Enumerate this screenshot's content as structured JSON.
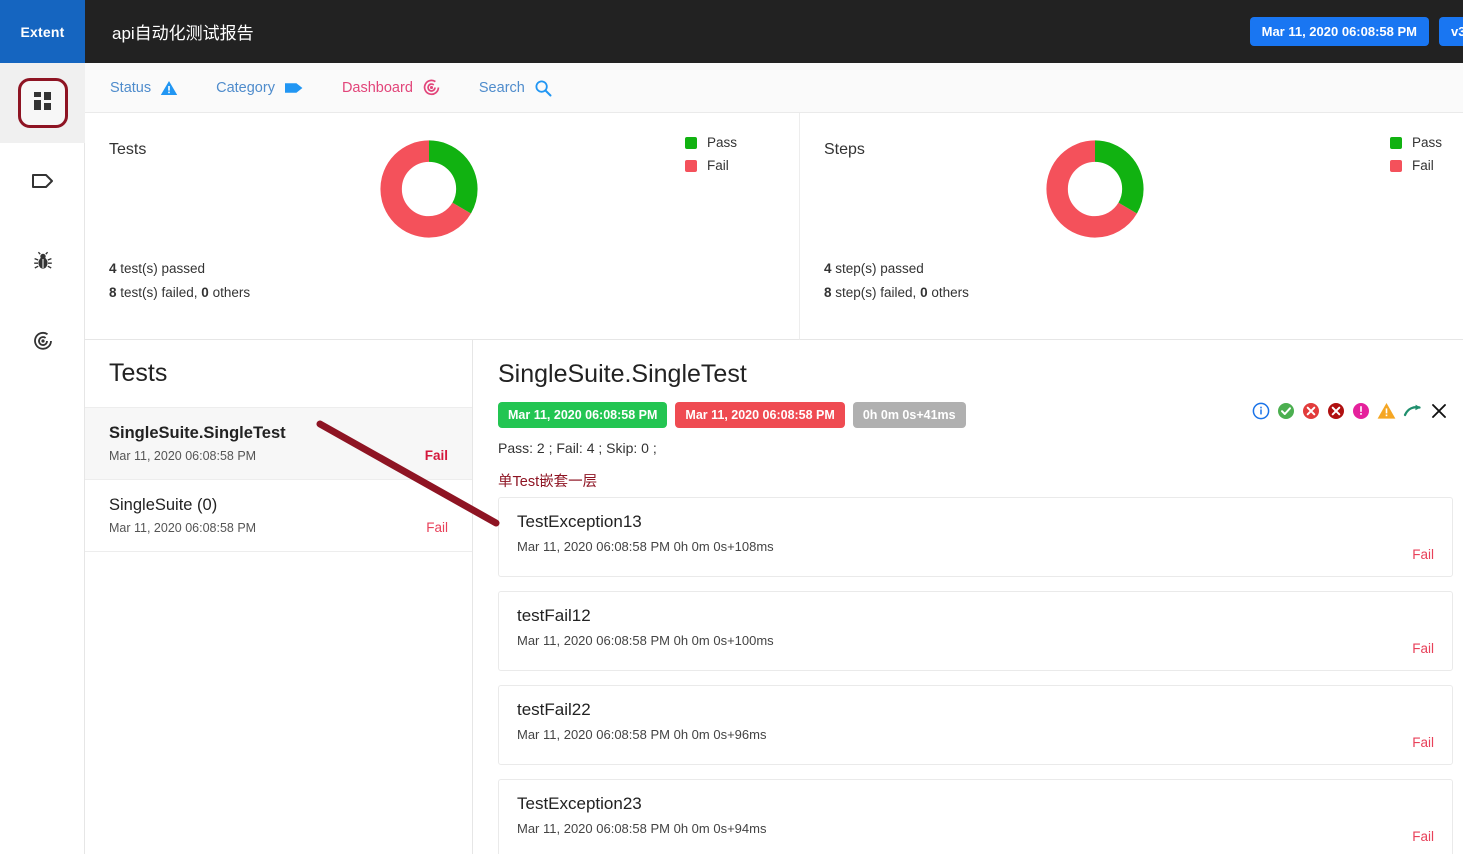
{
  "brand": {
    "logo_text": "Extent"
  },
  "header": {
    "title": "api自动化测试报告",
    "timestamp_badge": "Mar 11, 2020 06:08:58 PM",
    "version_badge": "v3"
  },
  "rail": {
    "items": [
      {
        "name": "dashboard",
        "icon": "grid-icon",
        "active": true
      },
      {
        "name": "categories",
        "icon": "tag-icon",
        "active": false
      },
      {
        "name": "exceptions",
        "icon": "bug-icon",
        "active": false
      },
      {
        "name": "dashboard-alt",
        "icon": "target-icon",
        "active": false
      }
    ]
  },
  "nav": {
    "items": [
      {
        "label": "Status",
        "icon": "warning-triangle-icon",
        "active": false
      },
      {
        "label": "Category",
        "icon": "tag-icon",
        "active": false
      },
      {
        "label": "Dashboard",
        "icon": "target-icon",
        "active": true
      },
      {
        "label": "Search",
        "icon": "search-icon",
        "active": false
      }
    ]
  },
  "charts": [
    {
      "title": "Tests",
      "legend": [
        {
          "label": "Pass",
          "color": "#11b211"
        },
        {
          "label": "Fail",
          "color": "#f4515b"
        }
      ],
      "footer_passed_count": "4",
      "footer_passed_text": " test(s) passed",
      "footer_failed_count": "8",
      "footer_failed_mid": " test(s) failed, ",
      "footer_others_count": "0",
      "footer_others_text": " others"
    },
    {
      "title": "Steps",
      "legend": [
        {
          "label": "Pass",
          "color": "#11b211"
        },
        {
          "label": "Fail",
          "color": "#f4515b"
        }
      ],
      "footer_passed_count": "4",
      "footer_passed_text": " step(s) passed",
      "footer_failed_count": "8",
      "footer_failed_mid": " step(s) failed, ",
      "footer_others_count": "0",
      "footer_others_text": " others"
    }
  ],
  "chart_data": [
    {
      "type": "pie",
      "title": "Tests",
      "variant": "donut",
      "labels": [
        "Pass",
        "Fail"
      ],
      "values": [
        4,
        8
      ],
      "colors": [
        "#11b211",
        "#f4515b"
      ],
      "total": 12,
      "legend_position": "right",
      "annotations": [
        "4 test(s) passed",
        "8 test(s) failed, 0 others"
      ]
    },
    {
      "type": "pie",
      "title": "Steps",
      "variant": "donut",
      "labels": [
        "Pass",
        "Fail"
      ],
      "values": [
        4,
        8
      ],
      "colors": [
        "#11b211",
        "#f4515b"
      ],
      "total": 12,
      "legend_position": "right",
      "annotations": [
        "4 step(s) passed",
        "8 step(s) failed, 0 others"
      ]
    }
  ],
  "tests_panel": {
    "heading": "Tests",
    "rows": [
      {
        "name": "SingleSuite.SingleTest",
        "date": "Mar 11, 2020 06:08:58 PM",
        "status": "Fail",
        "selected": true
      },
      {
        "name": "SingleSuite (0)",
        "date": "Mar 11, 2020 06:08:58 PM",
        "status": "Fail",
        "selected": false
      }
    ]
  },
  "detail": {
    "title": "SingleSuite.SingleTest",
    "pill_start": "Mar 11, 2020 06:08:58 PM",
    "pill_end": "Mar 11, 2020 06:08:58 PM",
    "pill_duration": "0h 0m 0s+41ms",
    "counts": "Pass: 2 ; Fail: 4 ; Skip: 0 ;",
    "icons": [
      {
        "name": "info-icon",
        "color": "#1a73e8"
      },
      {
        "name": "check-circle-icon",
        "color": "#4caf50"
      },
      {
        "name": "fail-circle-icon",
        "color": "#e23b3b"
      },
      {
        "name": "error-circle-icon",
        "color": "#b01010"
      },
      {
        "name": "warning-circle-icon",
        "color": "#e5219c"
      },
      {
        "name": "warning-triangle-icon",
        "color": "#f5a623"
      },
      {
        "name": "skip-arrow-icon",
        "color": "#1f8f6d"
      },
      {
        "name": "close-icon",
        "color": "#111111"
      }
    ],
    "section_label": "单Test嵌套一层",
    "steps": [
      {
        "name": "TestException13",
        "date": "Mar 11, 2020 06:08:58 PM",
        "duration": "0h 0m 0s+108ms",
        "status": "Fail"
      },
      {
        "name": "testFail12",
        "date": "Mar 11, 2020 06:08:58 PM",
        "duration": "0h 0m 0s+100ms",
        "status": "Fail"
      },
      {
        "name": "testFail22",
        "date": "Mar 11, 2020 06:08:58 PM",
        "duration": "0h 0m 0s+96ms",
        "status": "Fail"
      },
      {
        "name": "TestException23",
        "date": "Mar 11, 2020 06:08:58 PM",
        "duration": "0h 0m 0s+94ms",
        "status": "Fail"
      }
    ]
  },
  "annotation": {
    "color": "#8e1423"
  },
  "colors": {
    "brand_blue": "#1565c0",
    "accent_crimson": "#8e1423",
    "pass_green": "#11b211",
    "fail_red": "#f4515b",
    "nav_blue": "#4f8ccc",
    "nav_active_pink": "#e2457a"
  }
}
